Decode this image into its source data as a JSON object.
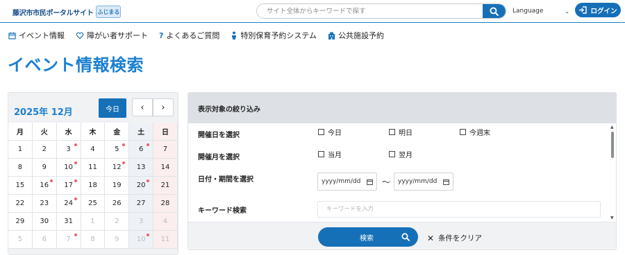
{
  "header": {
    "logo_text": "藤沢市市民ポータルサイト",
    "logo_badge": "ふじまる",
    "search_placeholder": "サイト全体からキーワードで探す",
    "language_label": "Language",
    "login_label": "ログイン"
  },
  "nav": {
    "items": [
      {
        "icon": "calendar-icon",
        "label": "イベント情報"
      },
      {
        "icon": "heart-hand-icon",
        "label": "障がい者サポート"
      },
      {
        "icon": "question-icon",
        "label": "よくあるご質問"
      },
      {
        "icon": "child-icon",
        "label": "特別保育予約システム"
      },
      {
        "icon": "building-icon",
        "label": "公共施設予約"
      }
    ]
  },
  "page_title": "イベント情報検索",
  "calendar": {
    "month_label": "2025年 12月",
    "today_label": "今日",
    "prev_label": "‹",
    "next_label": "›",
    "weekdays": [
      "月",
      "火",
      "水",
      "木",
      "金",
      "土",
      "日"
    ],
    "weeks": [
      [
        {
          "d": "1"
        },
        {
          "d": "2"
        },
        {
          "d": "3",
          "dot": true
        },
        {
          "d": "4"
        },
        {
          "d": "5",
          "dot": true
        },
        {
          "d": "6",
          "dot": true
        },
        {
          "d": "7"
        }
      ],
      [
        {
          "d": "8"
        },
        {
          "d": "9"
        },
        {
          "d": "10",
          "dot": true
        },
        {
          "d": "11"
        },
        {
          "d": "12",
          "dot": true
        },
        {
          "d": "13"
        },
        {
          "d": "14"
        }
      ],
      [
        {
          "d": "15"
        },
        {
          "d": "16",
          "dot": true
        },
        {
          "d": "17",
          "dot": true
        },
        {
          "d": "18"
        },
        {
          "d": "19"
        },
        {
          "d": "20",
          "dot": true
        },
        {
          "d": "21"
        }
      ],
      [
        {
          "d": "22"
        },
        {
          "d": "23"
        },
        {
          "d": "24",
          "dot": true
        },
        {
          "d": "25"
        },
        {
          "d": "26"
        },
        {
          "d": "27"
        },
        {
          "d": "28"
        }
      ],
      [
        {
          "d": "29"
        },
        {
          "d": "30"
        },
        {
          "d": "31"
        },
        {
          "d": "1",
          "other": true
        },
        {
          "d": "2",
          "other": true
        },
        {
          "d": "3",
          "other": true
        },
        {
          "d": "4",
          "other": true
        }
      ],
      [
        {
          "d": "5",
          "other": true
        },
        {
          "d": "6",
          "other": true
        },
        {
          "d": "7",
          "other": true,
          "dot": true
        },
        {
          "d": "8",
          "other": true
        },
        {
          "d": "9",
          "other": true
        },
        {
          "d": "10",
          "other": true,
          "dot": true
        },
        {
          "d": "11",
          "other": true
        }
      ]
    ]
  },
  "filter": {
    "heading": "表示対象の絞り込み",
    "date_label": "開催日を選択",
    "date_options": [
      "今日",
      "明日",
      "今週末"
    ],
    "month_label": "開催月を選択",
    "month_options": [
      "当月",
      "翌月"
    ],
    "period_label": "日付・期間を選択",
    "date_from_placeholder": "yyyy/mm/dd",
    "date_to_placeholder": "yyyy/mm/dd",
    "tilde": "〜",
    "keyword_label": "キーワード検索",
    "keyword_placeholder": "キーワードを入力",
    "search_label": "検索",
    "clear_label": "条件をクリア"
  },
  "colors": {
    "primary": "#1670b8",
    "title": "#1a7fd0",
    "event_dot": "#e8636e"
  }
}
